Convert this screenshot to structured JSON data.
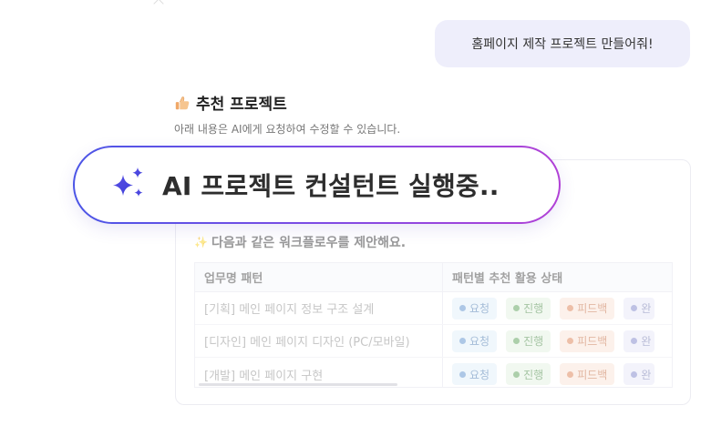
{
  "chat": {
    "user_message": "홈페이지 제작 프로젝트 만들어줘!"
  },
  "recommendation": {
    "title": "추천 프로젝트",
    "subtitle": "아래 내용은 AI에게 요청하여 수정할 수 있습니다."
  },
  "status_pill": {
    "text": "AI 프로젝트 컨설턴트 실행중.."
  },
  "workflow": {
    "heading": "다음과 같은 워크플로우를 제안해요.",
    "columns": [
      "업무명 패턴",
      "패턴별 추천 활용 상태"
    ],
    "rows": [
      {
        "task": "[기획] 메인 페이지 정보 구조 설계"
      },
      {
        "task": "[디자인] 메인 페이지 디자인 (PC/모바일)"
      },
      {
        "task": "[개발] 메인 페이지 구현"
      }
    ],
    "status_chips": [
      "요청",
      "진행",
      "피드백",
      "완"
    ]
  }
}
